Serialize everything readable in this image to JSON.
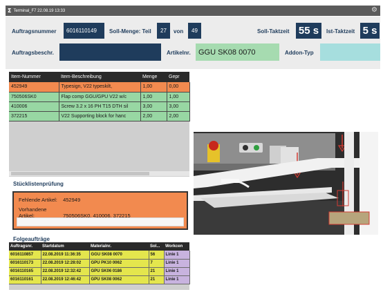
{
  "window": {
    "title": "Terminal_F7  22.08.19 13:33",
    "logo_glyph": "Σ",
    "settings_glyph": "⚙"
  },
  "header": {
    "auftragsnummer_label": "Auftragsnummer",
    "auftragsnummer_value": "6016110149",
    "soll_menge_label": "Soll-Menge: Teil",
    "teil_value": "27",
    "von_label": "von",
    "von_value": "49",
    "soll_takt_label": "Soll-Taktzeit",
    "soll_takt_value": "55 s",
    "ist_takt_label": "Ist-Taktzeit",
    "ist_takt_value": "5 s",
    "beschr_label": "Auftragsbeschr.",
    "beschr_value": "",
    "artikel_label": "Artikelnr.",
    "artikel_value": "GGU SK08 0070",
    "addon_label": "Addon-Typ",
    "addon_value": ""
  },
  "items_table": {
    "columns": [
      "Item-Nummer",
      "Item-Beschreibung",
      "Menge",
      "Gepr"
    ],
    "rows": [
      {
        "nr": "452949",
        "desc": "Typesign, V22 typeskilt,",
        "menge": "1,00",
        "gepr": "0,00",
        "status": "missing"
      },
      {
        "nr": "750506SK0",
        "desc": "Flap comp GGU/GPU V22 w/c",
        "menge": "1,00",
        "gepr": "1,00",
        "status": "ok"
      },
      {
        "nr": "410006",
        "desc": "Screw 3.2 x 16 PH T15 DTH  sil",
        "menge": "3,00",
        "gepr": "3,00",
        "status": "ok"
      },
      {
        "nr": "372215",
        "desc": "V22 Supporting block for hanc",
        "menge": "2,00",
        "gepr": "2,00",
        "status": "ok"
      }
    ]
  },
  "stueckliste": {
    "title": "Stücklistenprüfung",
    "fehlende_label": "Fehlende Artikel:",
    "fehlende_value": "452949",
    "vorhandene_label": "Vorhandene Artikel:",
    "vorhandene_value": "750506SK0, 410006, 372215"
  },
  "folge": {
    "title": "Folgeaufträge",
    "columns": [
      "Auftragsnr.",
      "Startdatum",
      "Materialnr.",
      "Sol...",
      "Workcen"
    ],
    "rows": [
      [
        "6016110857",
        "22.08.2019 11:36:35",
        "GGU SK08 0070",
        "56",
        "Linie 1"
      ],
      [
        "6016110173",
        "22.08.2019 12:28:02",
        "GPU PK10 0062",
        "7",
        "Linie 1"
      ],
      [
        "6016110165",
        "22.08.2019 12:32:42",
        "GPU SK06 0186",
        "21",
        "Linie 1"
      ],
      [
        "6016110161",
        "22.08.2019 12:46:42",
        "GPU SK08 0062",
        "21",
        "Linie 1"
      ]
    ]
  },
  "colors": {
    "accent": "#1f3c5c",
    "missing": "#f28a4f",
    "ok": "#98d7a3",
    "order": "#e4e64d",
    "workcenter": "#c8b3df"
  }
}
